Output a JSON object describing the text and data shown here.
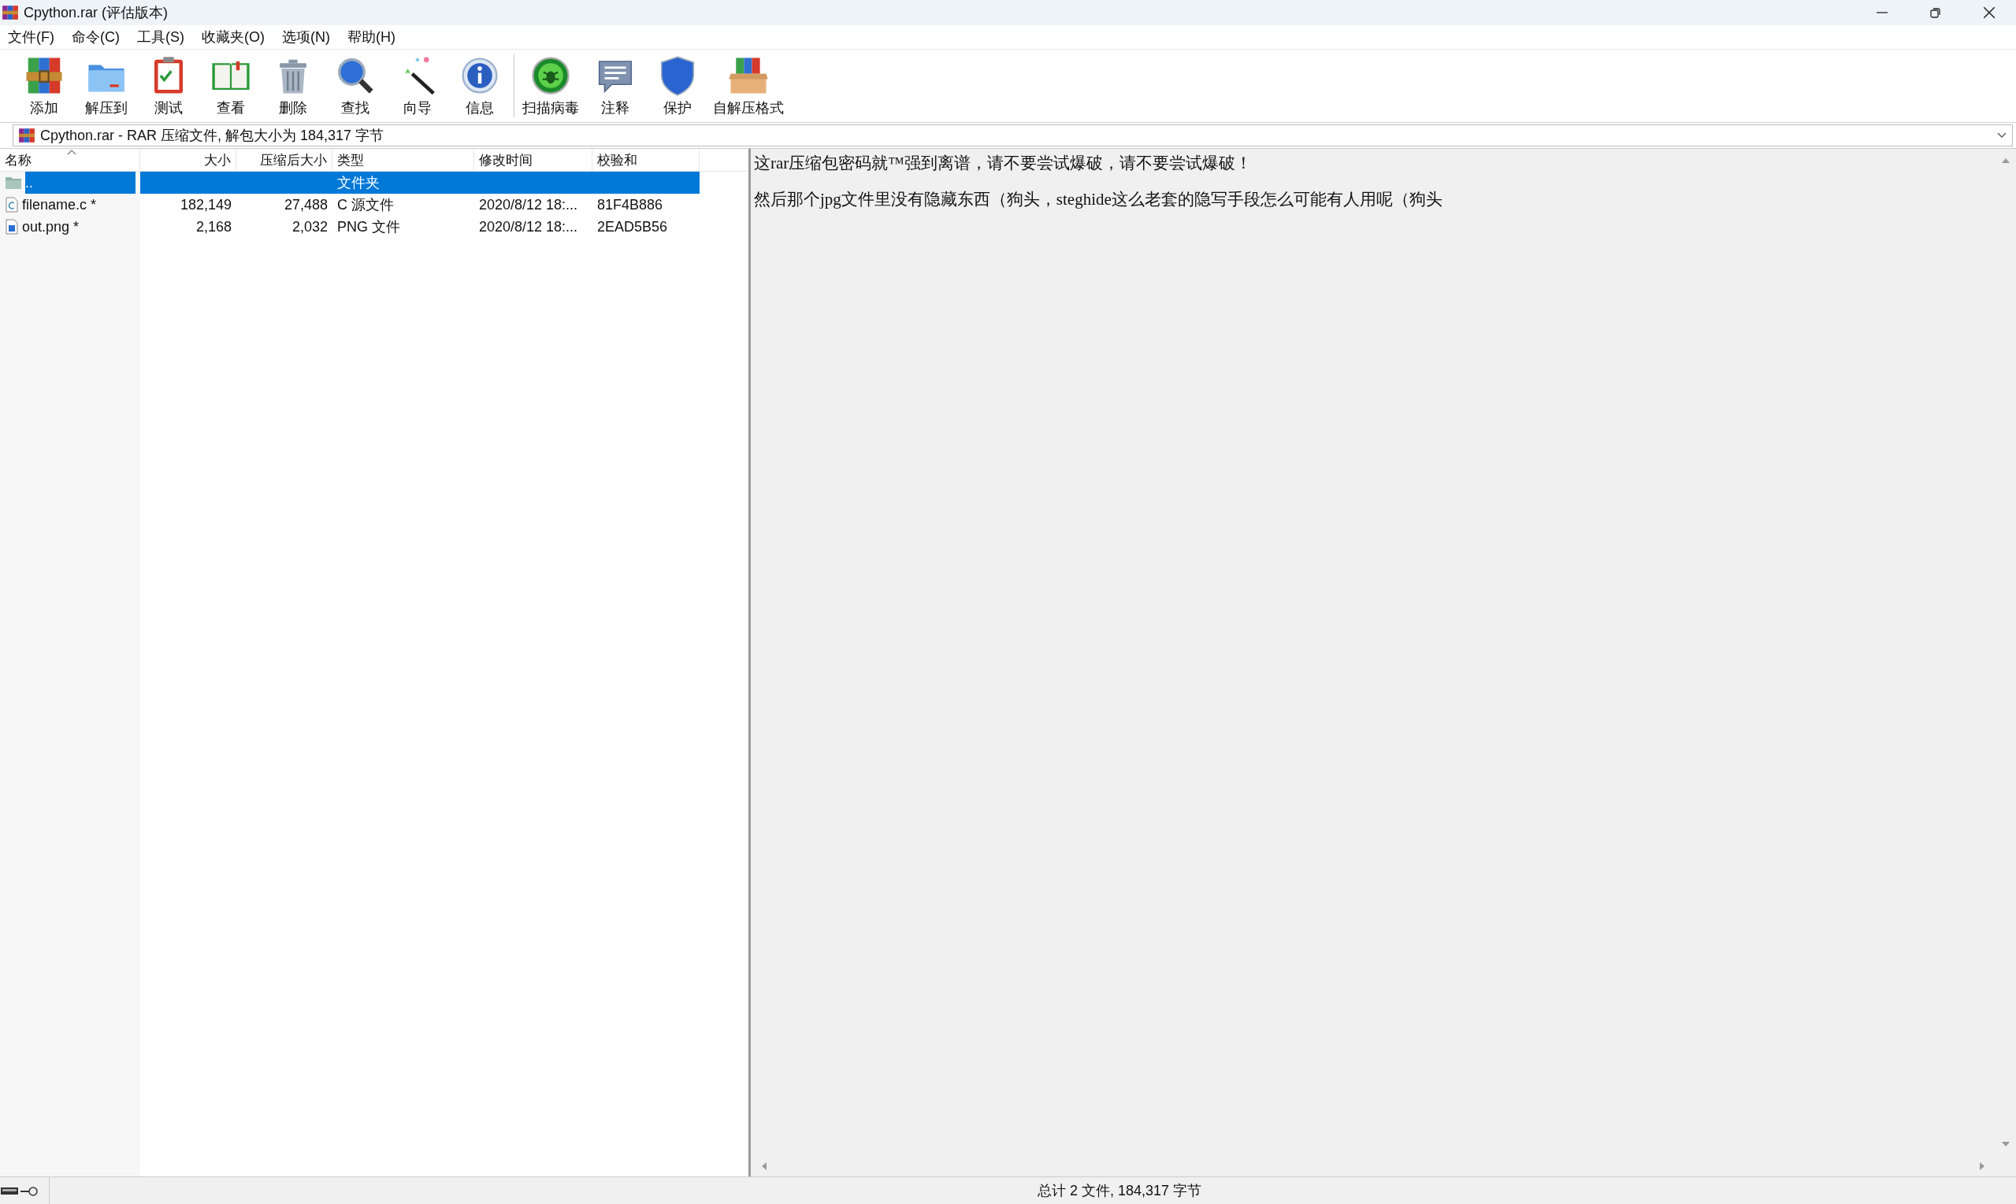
{
  "window": {
    "title": "Cpython.rar (评估版本)"
  },
  "menu": [
    "文件(F)",
    "命令(C)",
    "工具(S)",
    "收藏夹(O)",
    "选项(N)",
    "帮助(H)"
  ],
  "toolbar": {
    "groups": [
      [
        {
          "label": "添加",
          "kind": "add"
        },
        {
          "label": "解压到",
          "kind": "extract"
        },
        {
          "label": "测试",
          "kind": "test"
        },
        {
          "label": "查看",
          "kind": "view"
        },
        {
          "label": "删除",
          "kind": "delete"
        },
        {
          "label": "查找",
          "kind": "find"
        },
        {
          "label": "向导",
          "kind": "wizard"
        },
        {
          "label": "信息",
          "kind": "info"
        }
      ],
      [
        {
          "label": "扫描病毒",
          "kind": "virus"
        },
        {
          "label": "注释",
          "kind": "comment"
        },
        {
          "label": "保护",
          "kind": "protect"
        },
        {
          "label": "自解压格式",
          "kind": "sfx"
        }
      ]
    ]
  },
  "address": {
    "path": "Cpython.rar - RAR 压缩文件, 解包大小为 184,317 字节"
  },
  "table": {
    "columns": [
      "名称",
      "大小",
      "压缩后大小",
      "类型",
      "修改时间",
      "校验和"
    ],
    "rows": [
      {
        "kind": "folder",
        "selected": true,
        "name": "..",
        "size": "",
        "packed": "",
        "type": "文件夹",
        "modified": "",
        "crc": ""
      },
      {
        "kind": "c-file",
        "selected": false,
        "name": "filename.c *",
        "size": "182,149",
        "packed": "27,488",
        "type": "C 源文件",
        "modified": "2020/8/12 18:...",
        "crc": "81F4B886"
      },
      {
        "kind": "image-file",
        "selected": false,
        "name": "out.png *",
        "size": "2,168",
        "packed": "2,032",
        "type": "PNG 文件",
        "modified": "2020/8/12 18:...",
        "crc": "2EAD5B56"
      }
    ]
  },
  "comment": [
    "这rar压缩包密码就™强到离谱，请不要尝试爆破，请不要尝试爆破！",
    "然后那个jpg文件里没有隐藏东西（狗头，steghide这么老套的隐写手段怎么可能有人用呢（狗头"
  ],
  "status_bar": {
    "summary": "总计 2 文件, 184,317 字节"
  }
}
